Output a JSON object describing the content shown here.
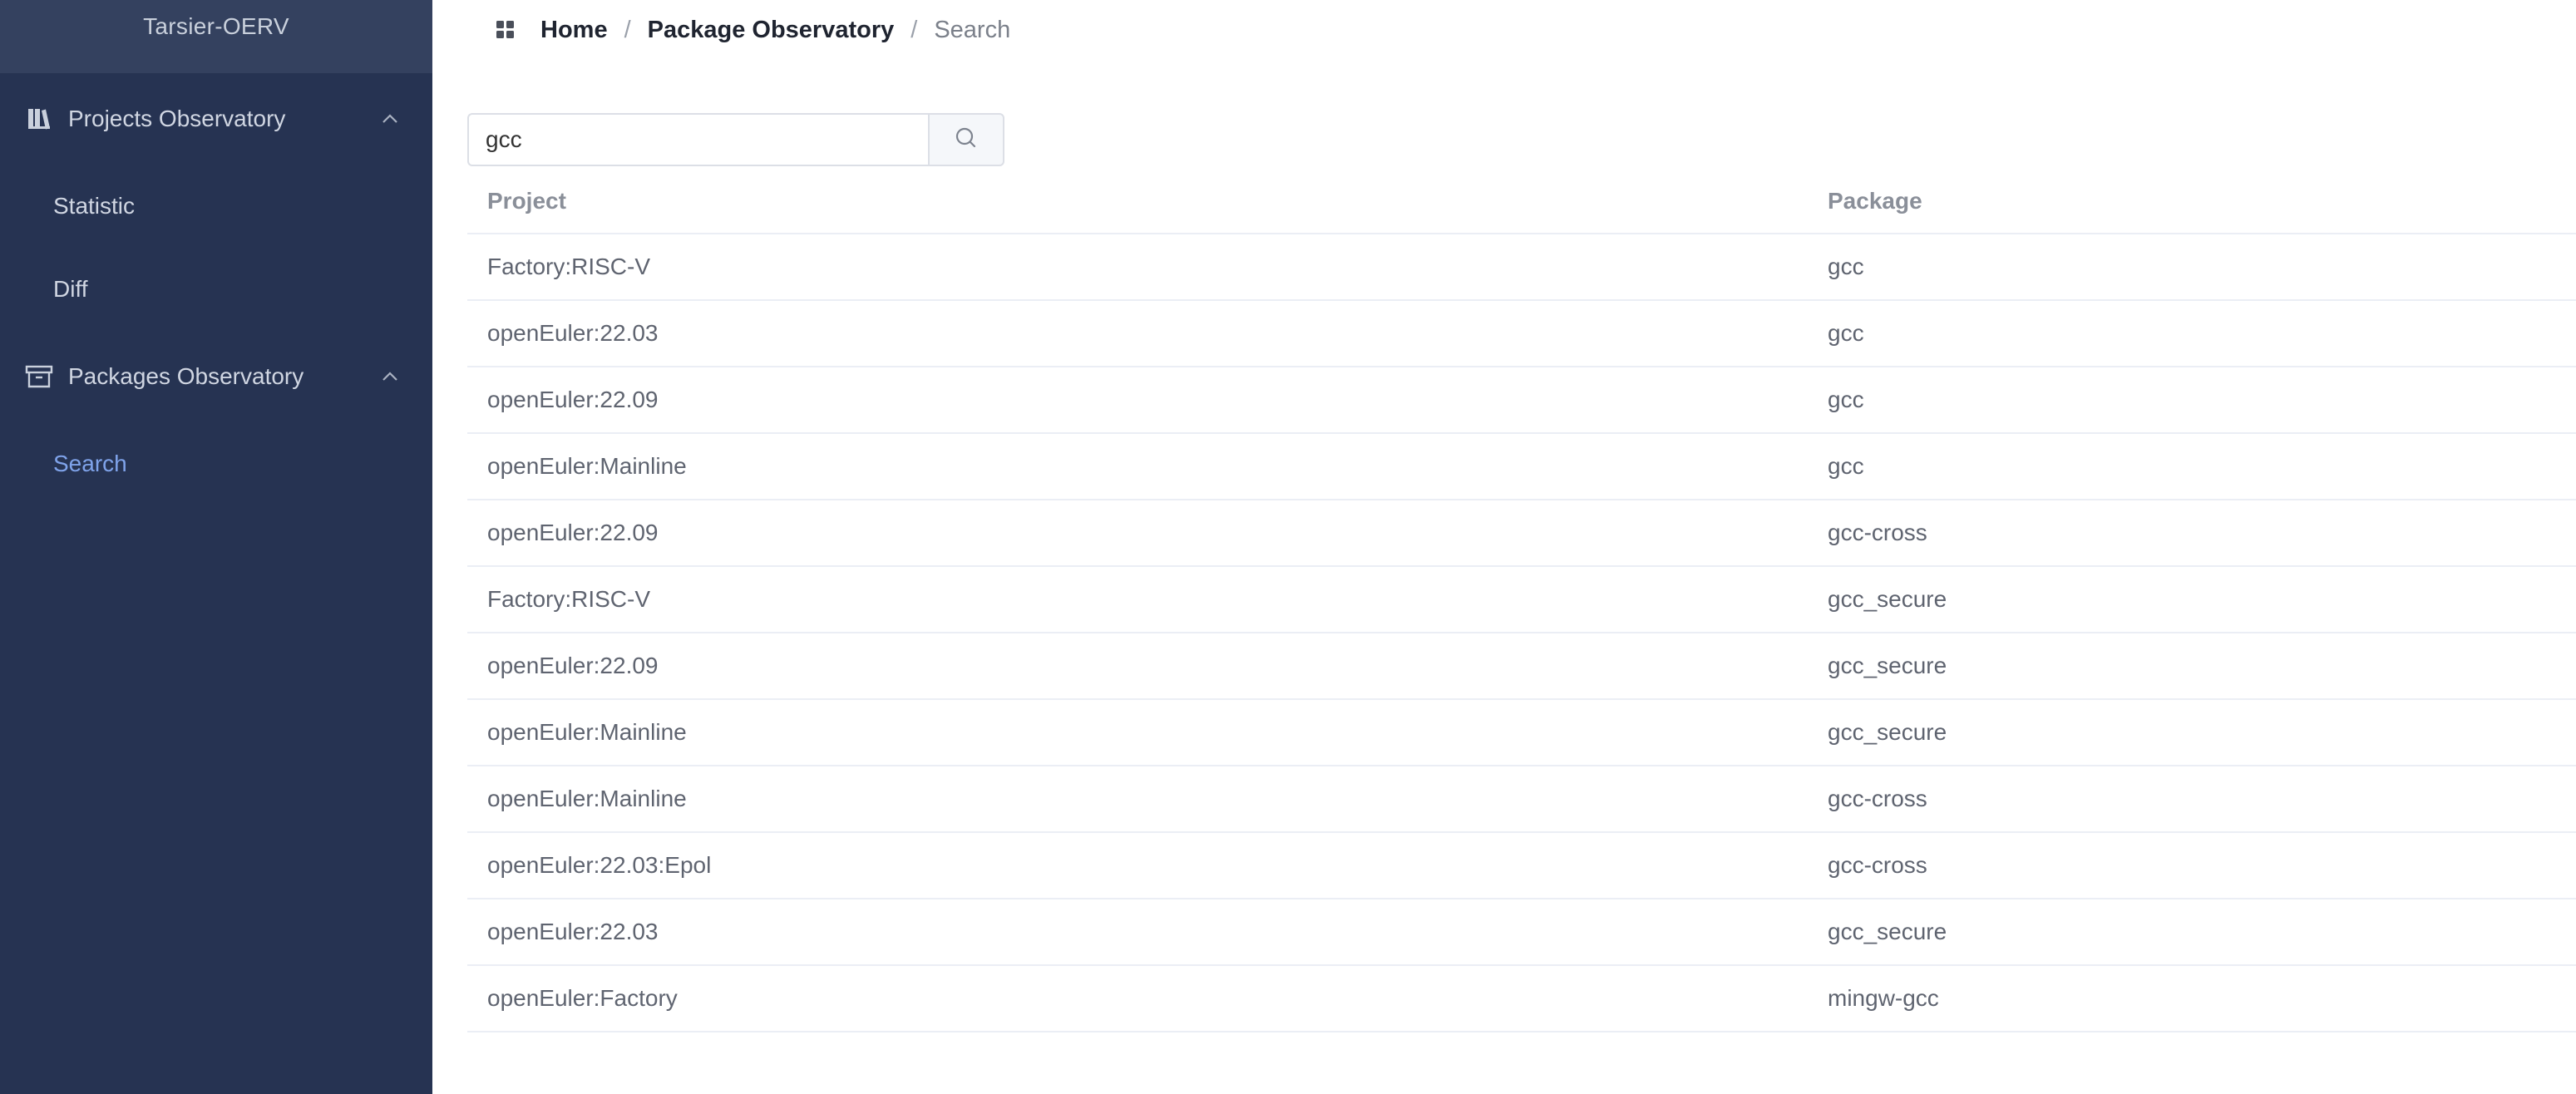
{
  "sidebar": {
    "brand": "Tarsier-OERV",
    "groups": [
      {
        "label": "Projects Observatory",
        "icon": "library-icon",
        "expanded": true,
        "items": [
          {
            "label": "Statistic",
            "active": false
          },
          {
            "label": "Diff",
            "active": false
          }
        ]
      },
      {
        "label": "Packages Observatory",
        "icon": "archive-box-icon",
        "expanded": true,
        "items": [
          {
            "label": "Search",
            "active": true
          }
        ]
      }
    ]
  },
  "breadcrumb": {
    "icon": "apps-grid-icon",
    "home": "Home",
    "section": "Package Observatory",
    "current": "Search",
    "separator": "/"
  },
  "search": {
    "value": "gcc",
    "button_icon": "search-icon"
  },
  "table": {
    "headers": {
      "project": "Project",
      "package": "Package"
    },
    "rows": [
      {
        "project": "Factory:RISC-V",
        "package": "gcc"
      },
      {
        "project": "openEuler:22.03",
        "package": "gcc"
      },
      {
        "project": "openEuler:22.09",
        "package": "gcc"
      },
      {
        "project": "openEuler:Mainline",
        "package": "gcc"
      },
      {
        "project": "openEuler:22.09",
        "package": "gcc-cross"
      },
      {
        "project": "Factory:RISC-V",
        "package": "gcc_secure"
      },
      {
        "project": "openEuler:22.09",
        "package": "gcc_secure"
      },
      {
        "project": "openEuler:Mainline",
        "package": "gcc_secure"
      },
      {
        "project": "openEuler:Mainline",
        "package": "gcc-cross"
      },
      {
        "project": "openEuler:22.03:Epol",
        "package": "gcc-cross"
      },
      {
        "project": "openEuler:22.03",
        "package": "gcc_secure"
      },
      {
        "project": "openEuler:Factory",
        "package": "mingw-gcc"
      }
    ]
  },
  "colors": {
    "sidebar_bg": "#263352",
    "brand_bg": "#34415f",
    "active_item": "#7fa3ea"
  }
}
